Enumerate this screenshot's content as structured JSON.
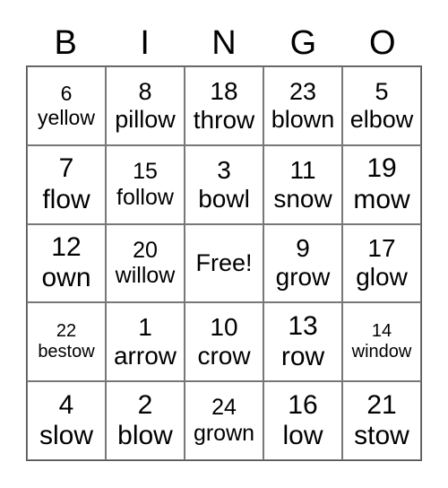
{
  "header": [
    "B",
    "I",
    "N",
    "G",
    "O"
  ],
  "cells": [
    "6\nyellow",
    "8\npillow",
    "18\nthrow",
    "23\nblown",
    "5\nelbow",
    "7\nflow",
    "15\nfollow",
    "3\nbowl",
    "11\nsnow",
    "19\nmow",
    "12\nown",
    "20\nwillow",
    "Free!",
    "9\ngrow",
    "17\nglow",
    "22\nbestow",
    "1\narrow",
    "10\ncrow",
    "13\nrow",
    "14\nwindow",
    "4\nslow",
    "2\nblow",
    "24\ngrown",
    "16\nlow",
    "21\nstow"
  ]
}
